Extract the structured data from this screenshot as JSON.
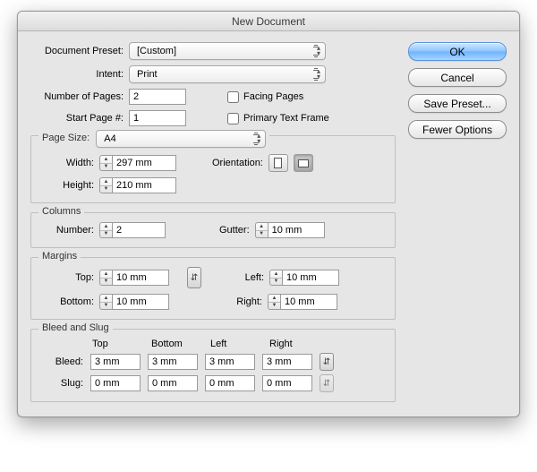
{
  "title": "New Document",
  "labels": {
    "docPreset": "Document Preset:",
    "intent": "Intent:",
    "numPages": "Number of Pages:",
    "startPage": "Start Page #:",
    "facingPages": "Facing Pages",
    "primaryTextFrame": "Primary Text Frame",
    "pageSizeGroup": "Page Size:",
    "width": "Width:",
    "height": "Height:",
    "orientation": "Orientation:",
    "columnsGroup": "Columns",
    "number": "Number:",
    "gutter": "Gutter:",
    "marginsGroup": "Margins",
    "top": "Top:",
    "bottom": "Bottom:",
    "left": "Left:",
    "right": "Right:",
    "bleedSlug": "Bleed and Slug",
    "bleed": "Bleed:",
    "slug": "Slug:",
    "colTop": "Top",
    "colBottom": "Bottom",
    "colLeft": "Left",
    "colRight": "Right"
  },
  "values": {
    "docPreset": "[Custom]",
    "intent": "Print",
    "numPages": "2",
    "startPage": "1",
    "facingPages": false,
    "primaryTextFrame": false,
    "pageSize": "A4",
    "width": "297 mm",
    "height": "210 mm",
    "colNumber": "2",
    "gutter": "10 mm",
    "marginTop": "10 mm",
    "marginBottom": "10 mm",
    "marginLeft": "10 mm",
    "marginRight": "10 mm",
    "bleedTop": "3 mm",
    "bleedBottom": "3 mm",
    "bleedLeft": "3 mm",
    "bleedRight": "3 mm",
    "slugTop": "0 mm",
    "slugBottom": "0 mm",
    "slugLeft": "0 mm",
    "slugRight": "0 mm"
  },
  "buttons": {
    "ok": "OK",
    "cancel": "Cancel",
    "savePreset": "Save Preset...",
    "fewerOptions": "Fewer Options"
  }
}
